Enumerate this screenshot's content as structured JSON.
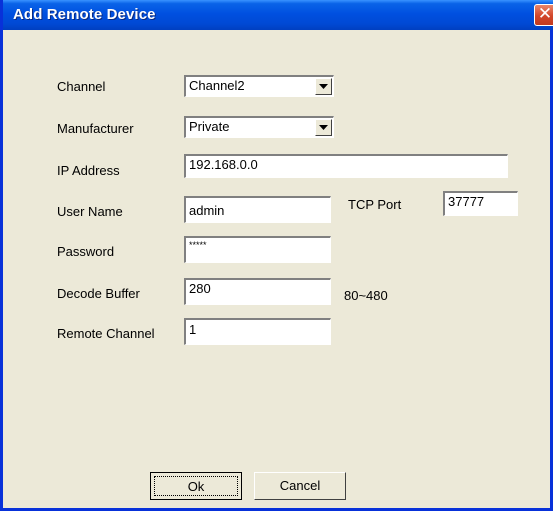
{
  "window": {
    "title": "Add Remote Device",
    "close_glyph": "✕"
  },
  "form": {
    "channel": {
      "label": "Channel",
      "value": "Channel2"
    },
    "manufacturer": {
      "label": "Manufacturer",
      "value": "Private"
    },
    "ip_address": {
      "label": "IP Address",
      "value": "192.168.0.0"
    },
    "user_name": {
      "label": "User Name",
      "value": "admin"
    },
    "tcp_port": {
      "label": "TCP Port",
      "value": "37777"
    },
    "password": {
      "label": "Password",
      "value": "*****"
    },
    "decode_buffer": {
      "label": "Decode Buffer",
      "value": "280",
      "range": "80~480"
    },
    "remote_channel": {
      "label": "Remote Channel",
      "value": "1"
    }
  },
  "buttons": {
    "ok_label": "Ok",
    "cancel_label": "Cancel"
  },
  "icons": {
    "close": "close-icon",
    "dropdown": "chevron-down-icon"
  },
  "colors": {
    "titlebar": "#0050e0",
    "dialog_bg": "#ece9d8",
    "close_button": "#d2462a"
  }
}
